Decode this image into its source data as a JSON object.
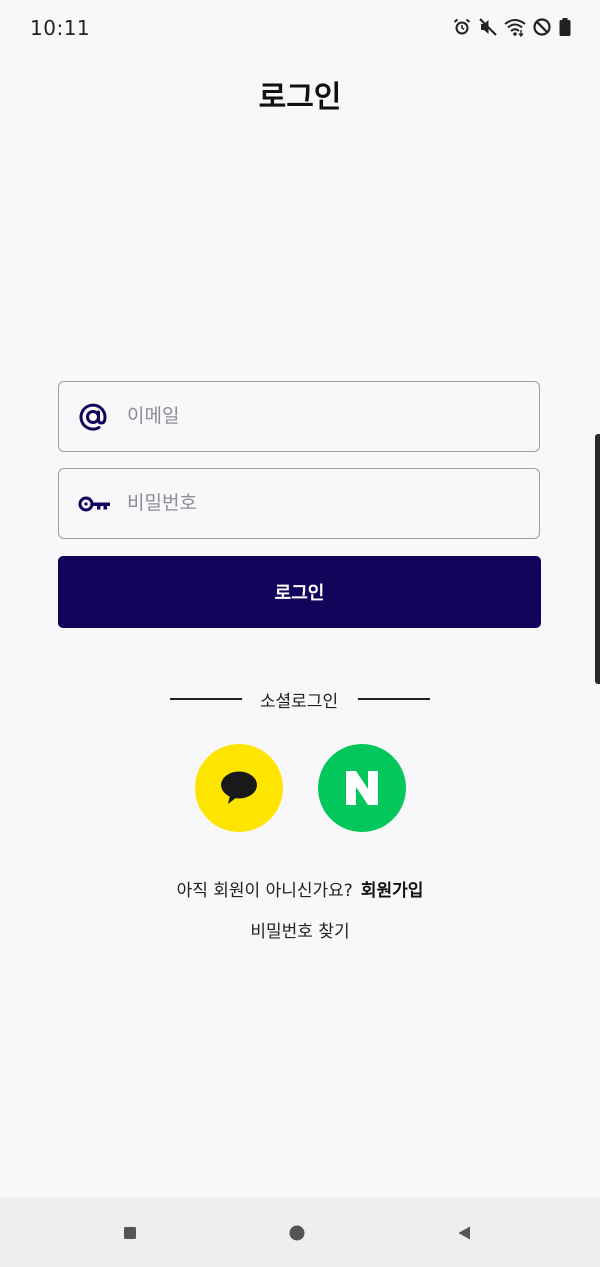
{
  "status_bar": {
    "time": "10:11",
    "icons": [
      "alarm-icon",
      "mute-icon",
      "wifi-icon",
      "do-not-disturb-icon",
      "battery-icon"
    ]
  },
  "header": {
    "title": "로그인"
  },
  "login_form": {
    "email": {
      "value": "",
      "placeholder": "이메일",
      "icon": "at-icon"
    },
    "password": {
      "value": "",
      "placeholder": "비밀번호",
      "icon": "key-icon"
    },
    "submit_label": "로그인"
  },
  "social": {
    "label": "소셜로그인",
    "providers": [
      {
        "name": "kakao",
        "icon": "speech-bubble-icon",
        "color": "#FEE500"
      },
      {
        "name": "naver",
        "icon": "naver-n-icon",
        "glyph": "N",
        "color": "#03C75A"
      }
    ]
  },
  "signup": {
    "prompt": "아직 회원이 아니신가요?",
    "link": "회원가입"
  },
  "find_password": "비밀번호 찾기",
  "nav_bar": {
    "buttons": [
      "recents-square-icon",
      "home-circle-icon",
      "back-triangle-icon"
    ]
  },
  "colors": {
    "primary": "#12045A",
    "background": "#F8F7FA",
    "kakao": "#FEE500",
    "naver": "#03C75A"
  }
}
